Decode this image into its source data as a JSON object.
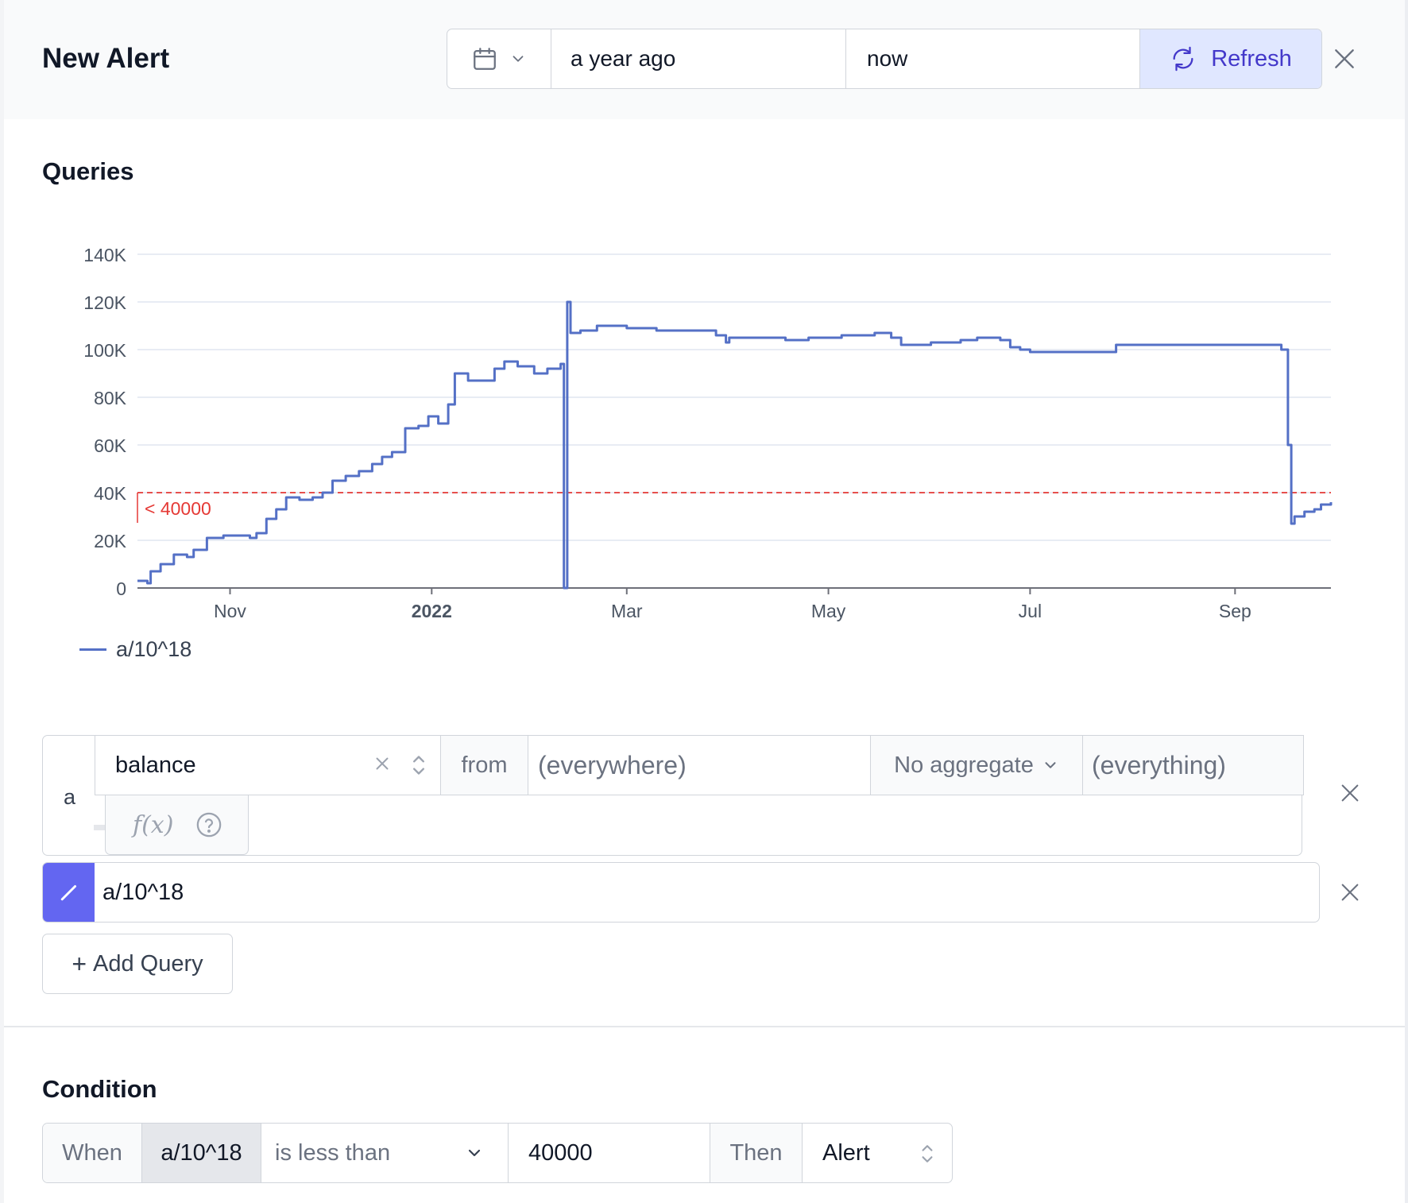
{
  "header": {
    "title": "New Alert",
    "time_from": "a year ago",
    "time_to": "now",
    "refresh_label": "Refresh"
  },
  "queries": {
    "section_title": "Queries",
    "query_letter": "a",
    "metric": "balance",
    "from_label": "from",
    "where_placeholder": "(everywhere)",
    "aggregate": "No aggregate",
    "group_placeholder": "(everything)",
    "fx_label": "f(x)",
    "formula": "a/10^18",
    "add_query_label": "Add Query"
  },
  "condition": {
    "section_title": "Condition",
    "when_label": "When",
    "metric": "a/10^18",
    "operator": "is less than",
    "value": "40000",
    "then_label": "Then",
    "action": "Alert"
  },
  "colors": {
    "series": "#5470c6",
    "threshold": "#e53935",
    "accent": "#6366f1",
    "refresh_bg": "#e0e7ff",
    "refresh_text": "#4338ca"
  },
  "icons": {
    "calendar": "calendar-icon",
    "chevron": "chevron-down-icon",
    "refresh": "refresh-icon",
    "close": "close-icon",
    "edit": "pencil-icon",
    "help": "help-icon",
    "updown": "updown-icon"
  },
  "chart_data": {
    "type": "line",
    "title": "",
    "xlabel": "",
    "ylabel": "",
    "ylim": [
      0,
      140000
    ],
    "y_ticks": [
      0,
      20000,
      40000,
      60000,
      80000,
      100000,
      120000,
      140000
    ],
    "y_tick_labels": [
      "0",
      "20K",
      "40K",
      "60K",
      "80K",
      "100K",
      "120K",
      "140K"
    ],
    "x_range": [
      "2021-10-04",
      "2022-09-30"
    ],
    "x_ticks": [
      {
        "date": "2021-11-01",
        "label": "Nov",
        "bold": false
      },
      {
        "date": "2022-01-01",
        "label": "2022",
        "bold": true
      },
      {
        "date": "2022-03-01",
        "label": "Mar",
        "bold": false
      },
      {
        "date": "2022-05-01",
        "label": "May",
        "bold": false
      },
      {
        "date": "2022-07-01",
        "label": "Jul",
        "bold": false
      },
      {
        "date": "2022-09-01",
        "label": "Sep",
        "bold": false
      }
    ],
    "grid": true,
    "legend_position": "bottom-left",
    "threshold": {
      "value": 40000,
      "label": "< 40000"
    },
    "series": [
      {
        "name": "a/10^18",
        "points": [
          [
            "2021-10-04",
            3000
          ],
          [
            "2021-10-07",
            2000
          ],
          [
            "2021-10-08",
            7000
          ],
          [
            "2021-10-11",
            10000
          ],
          [
            "2021-10-15",
            14000
          ],
          [
            "2021-10-19",
            13000
          ],
          [
            "2021-10-21",
            16000
          ],
          [
            "2021-10-25",
            21000
          ],
          [
            "2021-10-30",
            22000
          ],
          [
            "2021-11-04",
            22000
          ],
          [
            "2021-11-07",
            21000
          ],
          [
            "2021-11-09",
            23000
          ],
          [
            "2021-11-12",
            29000
          ],
          [
            "2021-11-15",
            33000
          ],
          [
            "2021-11-18",
            38000
          ],
          [
            "2021-11-22",
            37000
          ],
          [
            "2021-11-26",
            38000
          ],
          [
            "2021-11-29",
            40000
          ],
          [
            "2021-12-02",
            45000
          ],
          [
            "2021-12-06",
            47000
          ],
          [
            "2021-12-10",
            49000
          ],
          [
            "2021-12-14",
            52000
          ],
          [
            "2021-12-17",
            55000
          ],
          [
            "2021-12-20",
            57000
          ],
          [
            "2021-12-24",
            67000
          ],
          [
            "2021-12-28",
            68000
          ],
          [
            "2021-12-31",
            72000
          ],
          [
            "2022-01-03",
            69000
          ],
          [
            "2022-01-06",
            77000
          ],
          [
            "2022-01-08",
            90000
          ],
          [
            "2022-01-12",
            87000
          ],
          [
            "2022-01-17",
            87000
          ],
          [
            "2022-01-20",
            92000
          ],
          [
            "2022-01-23",
            95000
          ],
          [
            "2022-01-27",
            93000
          ],
          [
            "2022-02-01",
            90000
          ],
          [
            "2022-02-05",
            92000
          ],
          [
            "2022-02-09",
            94000
          ],
          [
            "2022-02-10",
            93000
          ],
          [
            "2022-02-10",
            0
          ],
          [
            "2022-02-11",
            0
          ],
          [
            "2022-02-11",
            120000
          ],
          [
            "2022-02-12",
            107000
          ],
          [
            "2022-02-15",
            108000
          ],
          [
            "2022-02-20",
            110000
          ],
          [
            "2022-03-01",
            109000
          ],
          [
            "2022-03-05",
            109000
          ],
          [
            "2022-03-10",
            108000
          ],
          [
            "2022-03-25",
            108000
          ],
          [
            "2022-03-28",
            106000
          ],
          [
            "2022-03-31",
            103000
          ],
          [
            "2022-04-01",
            105000
          ],
          [
            "2022-04-15",
            105000
          ],
          [
            "2022-04-18",
            104000
          ],
          [
            "2022-04-25",
            105000
          ],
          [
            "2022-05-05",
            106000
          ],
          [
            "2022-05-15",
            107000
          ],
          [
            "2022-05-20",
            105000
          ],
          [
            "2022-05-23",
            102000
          ],
          [
            "2022-06-01",
            103000
          ],
          [
            "2022-06-10",
            104000
          ],
          [
            "2022-06-15",
            105000
          ],
          [
            "2022-06-22",
            104000
          ],
          [
            "2022-06-25",
            101000
          ],
          [
            "2022-06-28",
            100000
          ],
          [
            "2022-07-01",
            99000
          ],
          [
            "2022-07-15",
            99000
          ],
          [
            "2022-07-25",
            99000
          ],
          [
            "2022-07-27",
            102000
          ],
          [
            "2022-08-10",
            102000
          ],
          [
            "2022-08-25",
            102000
          ],
          [
            "2022-09-05",
            102000
          ],
          [
            "2022-09-13",
            102000
          ],
          [
            "2022-09-15",
            100000
          ],
          [
            "2022-09-17",
            60000
          ],
          [
            "2022-09-18",
            27000
          ],
          [
            "2022-09-19",
            30000
          ],
          [
            "2022-09-22",
            32000
          ],
          [
            "2022-09-25",
            33000
          ],
          [
            "2022-09-27",
            35000
          ],
          [
            "2022-09-30",
            36000
          ]
        ]
      }
    ]
  }
}
